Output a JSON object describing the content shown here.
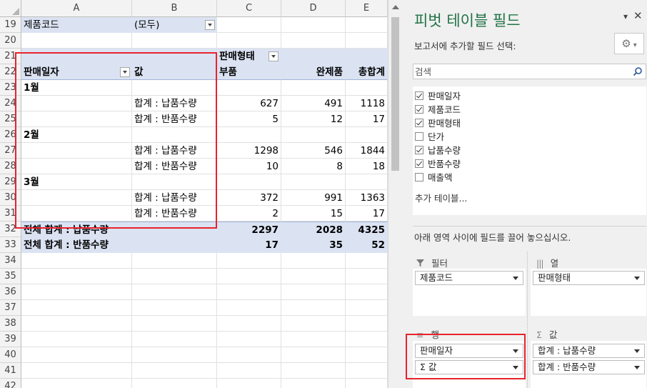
{
  "grid": {
    "columns": [
      "A",
      "B",
      "C",
      "D",
      "E"
    ],
    "rows": [
      {
        "num": "19",
        "a": "제품코드",
        "b": "(모두)",
        "c": "",
        "d": "",
        "e": ""
      },
      {
        "num": "20",
        "a": "",
        "b": "",
        "c": "",
        "d": "",
        "e": ""
      },
      {
        "num": "21",
        "a": "",
        "b": "",
        "c": "판매형태",
        "d": "",
        "e": ""
      },
      {
        "num": "22",
        "a": "판매일자",
        "b": "값",
        "c": "부품",
        "d": "완제품",
        "e": "총합계"
      },
      {
        "num": "23",
        "a": "1월",
        "b": "",
        "c": "",
        "d": "",
        "e": ""
      },
      {
        "num": "24",
        "a": "",
        "b": "합계 : 납품수량",
        "c": "627",
        "d": "491",
        "e": "1118"
      },
      {
        "num": "25",
        "a": "",
        "b": "합계 : 반품수량",
        "c": "5",
        "d": "12",
        "e": "17"
      },
      {
        "num": "26",
        "a": "2월",
        "b": "",
        "c": "",
        "d": "",
        "e": ""
      },
      {
        "num": "27",
        "a": "",
        "b": "합계 : 납품수량",
        "c": "1298",
        "d": "546",
        "e": "1844"
      },
      {
        "num": "28",
        "a": "",
        "b": "합계 : 반품수량",
        "c": "10",
        "d": "8",
        "e": "18"
      },
      {
        "num": "29",
        "a": "3월",
        "b": "",
        "c": "",
        "d": "",
        "e": ""
      },
      {
        "num": "30",
        "a": "",
        "b": "합계 : 납품수량",
        "c": "372",
        "d": "991",
        "e": "1363"
      },
      {
        "num": "31",
        "a": "",
        "b": "합계 : 반품수량",
        "c": "2",
        "d": "15",
        "e": "17"
      },
      {
        "num": "32",
        "a": "전체 합계 : 납품수량",
        "b": "",
        "c": "2297",
        "d": "2028",
        "e": "4325"
      },
      {
        "num": "33",
        "a": "전체 합계 : 반품수량",
        "b": "",
        "c": "17",
        "d": "35",
        "e": "52"
      },
      {
        "num": "34",
        "a": "",
        "b": "",
        "c": "",
        "d": "",
        "e": ""
      },
      {
        "num": "35",
        "a": "",
        "b": "",
        "c": "",
        "d": "",
        "e": ""
      },
      {
        "num": "36",
        "a": "",
        "b": "",
        "c": "",
        "d": "",
        "e": ""
      },
      {
        "num": "37",
        "a": "",
        "b": "",
        "c": "",
        "d": "",
        "e": ""
      },
      {
        "num": "38",
        "a": "",
        "b": "",
        "c": "",
        "d": "",
        "e": ""
      },
      {
        "num": "39",
        "a": "",
        "b": "",
        "c": "",
        "d": "",
        "e": ""
      },
      {
        "num": "40",
        "a": "",
        "b": "",
        "c": "",
        "d": "",
        "e": ""
      },
      {
        "num": "41",
        "a": "",
        "b": "",
        "c": "",
        "d": "",
        "e": ""
      },
      {
        "num": "42",
        "a": "",
        "b": "",
        "c": "",
        "d": "",
        "e": ""
      }
    ]
  },
  "panel": {
    "title": "피벗 테이블 필드",
    "choose_label": "보고서에 추가할 필드 선택:",
    "search_placeholder": "검색",
    "fields": [
      {
        "label": "판매일자",
        "checked": true
      },
      {
        "label": "제품코드",
        "checked": true
      },
      {
        "label": "판매형태",
        "checked": true
      },
      {
        "label": "단가",
        "checked": false
      },
      {
        "label": "납품수량",
        "checked": true
      },
      {
        "label": "반품수량",
        "checked": true
      },
      {
        "label": "매출액",
        "checked": false
      }
    ],
    "more_tables": "추가 테이블...",
    "drag_label": "아래 영역 사이에 필드를 끌어 놓으십시오.",
    "areas": {
      "filter": {
        "label": "필터",
        "items": [
          "제품코드"
        ]
      },
      "columns": {
        "label": "열",
        "items": [
          "판매형태"
        ]
      },
      "rows": {
        "label": "행",
        "items": [
          "판매일자",
          "Σ 값"
        ]
      },
      "values": {
        "label": "값",
        "items": [
          "합계 : 납품수량",
          "합계 : 반품수량"
        ]
      }
    }
  }
}
